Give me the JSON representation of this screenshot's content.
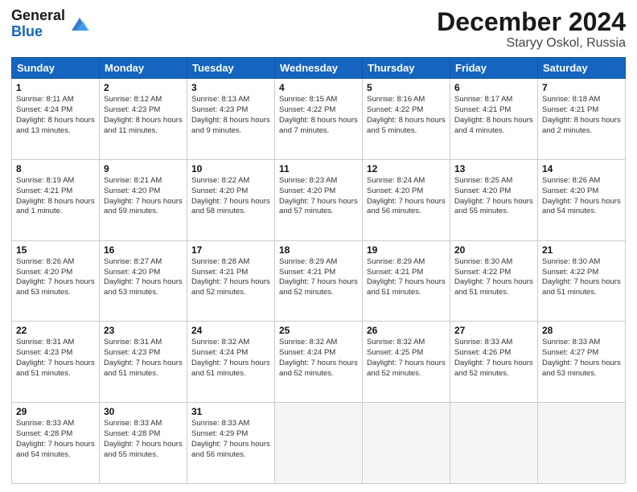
{
  "header": {
    "logo_line1": "General",
    "logo_line2": "Blue",
    "month": "December 2024",
    "location": "Staryy Oskol, Russia"
  },
  "weekdays": [
    "Sunday",
    "Monday",
    "Tuesday",
    "Wednesday",
    "Thursday",
    "Friday",
    "Saturday"
  ],
  "weeks": [
    [
      {
        "day": "1",
        "sr": "8:11 AM",
        "ss": "4:24 PM",
        "dl": "8 hours and 13 minutes."
      },
      {
        "day": "2",
        "sr": "8:12 AM",
        "ss": "4:23 PM",
        "dl": "8 hours and 11 minutes."
      },
      {
        "day": "3",
        "sr": "8:13 AM",
        "ss": "4:23 PM",
        "dl": "8 hours and 9 minutes."
      },
      {
        "day": "4",
        "sr": "8:15 AM",
        "ss": "4:22 PM",
        "dl": "8 hours and 7 minutes."
      },
      {
        "day": "5",
        "sr": "8:16 AM",
        "ss": "4:22 PM",
        "dl": "8 hours and 5 minutes."
      },
      {
        "day": "6",
        "sr": "8:17 AM",
        "ss": "4:21 PM",
        "dl": "8 hours and 4 minutes."
      },
      {
        "day": "7",
        "sr": "8:18 AM",
        "ss": "4:21 PM",
        "dl": "8 hours and 2 minutes."
      }
    ],
    [
      {
        "day": "8",
        "sr": "8:19 AM",
        "ss": "4:21 PM",
        "dl": "8 hours and 1 minute."
      },
      {
        "day": "9",
        "sr": "8:21 AM",
        "ss": "4:20 PM",
        "dl": "7 hours and 59 minutes."
      },
      {
        "day": "10",
        "sr": "8:22 AM",
        "ss": "4:20 PM",
        "dl": "7 hours and 58 minutes."
      },
      {
        "day": "11",
        "sr": "8:23 AM",
        "ss": "4:20 PM",
        "dl": "7 hours and 57 minutes."
      },
      {
        "day": "12",
        "sr": "8:24 AM",
        "ss": "4:20 PM",
        "dl": "7 hours and 56 minutes."
      },
      {
        "day": "13",
        "sr": "8:25 AM",
        "ss": "4:20 PM",
        "dl": "7 hours and 55 minutes."
      },
      {
        "day": "14",
        "sr": "8:26 AM",
        "ss": "4:20 PM",
        "dl": "7 hours and 54 minutes."
      }
    ],
    [
      {
        "day": "15",
        "sr": "8:26 AM",
        "ss": "4:20 PM",
        "dl": "7 hours and 53 minutes."
      },
      {
        "day": "16",
        "sr": "8:27 AM",
        "ss": "4:20 PM",
        "dl": "7 hours and 53 minutes."
      },
      {
        "day": "17",
        "sr": "8:28 AM",
        "ss": "4:21 PM",
        "dl": "7 hours and 52 minutes."
      },
      {
        "day": "18",
        "sr": "8:29 AM",
        "ss": "4:21 PM",
        "dl": "7 hours and 52 minutes."
      },
      {
        "day": "19",
        "sr": "8:29 AM",
        "ss": "4:21 PM",
        "dl": "7 hours and 51 minutes."
      },
      {
        "day": "20",
        "sr": "8:30 AM",
        "ss": "4:22 PM",
        "dl": "7 hours and 51 minutes."
      },
      {
        "day": "21",
        "sr": "8:30 AM",
        "ss": "4:22 PM",
        "dl": "7 hours and 51 minutes."
      }
    ],
    [
      {
        "day": "22",
        "sr": "8:31 AM",
        "ss": "4:23 PM",
        "dl": "7 hours and 51 minutes."
      },
      {
        "day": "23",
        "sr": "8:31 AM",
        "ss": "4:23 PM",
        "dl": "7 hours and 51 minutes."
      },
      {
        "day": "24",
        "sr": "8:32 AM",
        "ss": "4:24 PM",
        "dl": "7 hours and 51 minutes."
      },
      {
        "day": "25",
        "sr": "8:32 AM",
        "ss": "4:24 PM",
        "dl": "7 hours and 52 minutes."
      },
      {
        "day": "26",
        "sr": "8:32 AM",
        "ss": "4:25 PM",
        "dl": "7 hours and 52 minutes."
      },
      {
        "day": "27",
        "sr": "8:33 AM",
        "ss": "4:26 PM",
        "dl": "7 hours and 52 minutes."
      },
      {
        "day": "28",
        "sr": "8:33 AM",
        "ss": "4:27 PM",
        "dl": "7 hours and 53 minutes."
      }
    ],
    [
      {
        "day": "29",
        "sr": "8:33 AM",
        "ss": "4:28 PM",
        "dl": "7 hours and 54 minutes."
      },
      {
        "day": "30",
        "sr": "8:33 AM",
        "ss": "4:28 PM",
        "dl": "7 hours and 55 minutes."
      },
      {
        "day": "31",
        "sr": "8:33 AM",
        "ss": "4:29 PM",
        "dl": "7 hours and 56 minutes."
      },
      null,
      null,
      null,
      null
    ]
  ]
}
